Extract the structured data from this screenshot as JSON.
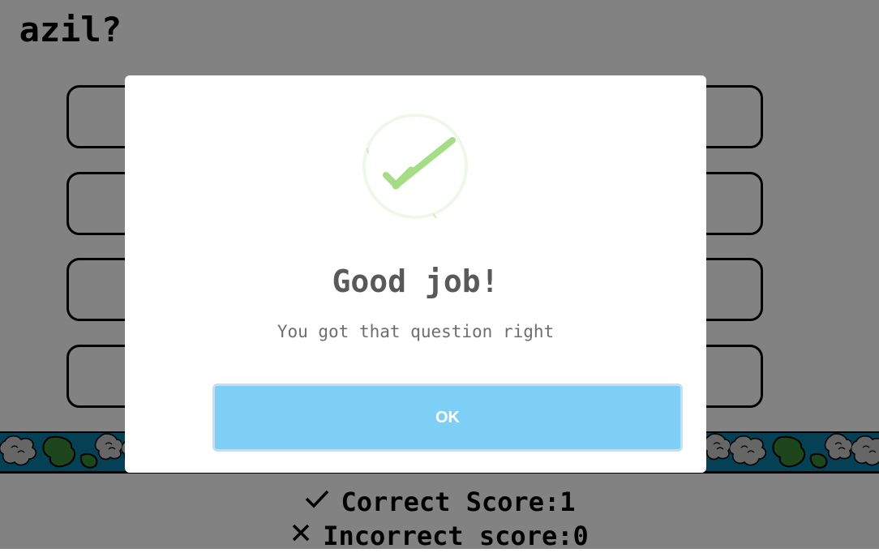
{
  "quiz": {
    "question_fragment": "azil?",
    "answer_count": 4
  },
  "scores": {
    "correct_icon": "check-icon",
    "correct_text": "Correct Score:1",
    "incorrect_icon": "x-icon",
    "incorrect_text": "Incorrect score:0"
  },
  "modal": {
    "icon": "success-check-icon",
    "title": "Good job!",
    "text": "You got that question right",
    "ok_label": "OK"
  },
  "colors": {
    "overlay": "#00000080",
    "modal_bg": "#ffffff",
    "success_green": "#a5dc86",
    "ok_button": "#7ecff5",
    "banner_water": "#0a7fa8",
    "banner_land": "#3a8a3a",
    "banner_cloud": "#c8c8c8"
  }
}
